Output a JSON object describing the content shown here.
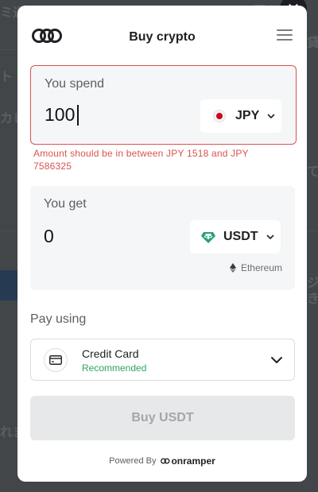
{
  "background": {
    "texts": [
      "ミ返",
      "同キン",
      "ト",
      "カレ",
      "貸",
      "て",
      "ジ",
      "きま",
      "れま"
    ]
  },
  "close_glyph": "✕",
  "header": {
    "title": "Buy crypto",
    "logo_icon": "onramper-logo-icon",
    "menu_icon": "hamburger-menu-icon"
  },
  "spend": {
    "label": "You spend",
    "amount": "100",
    "currency": "JPY",
    "flag_icon": "japan-flag-icon",
    "error": "Amount should be in between JPY 1518 and JPY 7586325"
  },
  "get": {
    "label": "You get",
    "amount": "0",
    "currency": "USDT",
    "token_icon": "tether-icon",
    "network": "Ethereum",
    "network_icon": "ethereum-icon"
  },
  "payment": {
    "label": "Pay using",
    "method": "Credit Card",
    "tag": "Recommended"
  },
  "buy_button": "Buy USDT",
  "footer": {
    "powered_by": "Powered By",
    "brand": "onramper"
  },
  "colors": {
    "error": "#d9534f",
    "recommended": "#2fa65a",
    "tether": "#26a17b",
    "jp_red": "#d0021b"
  }
}
